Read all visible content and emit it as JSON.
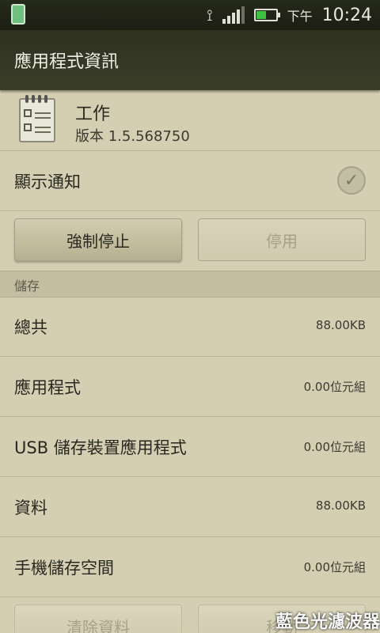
{
  "status_bar": {
    "ampm": "下午",
    "time": "10:24",
    "icons": [
      "phone-icon",
      "vibrate-icon",
      "signal-icon",
      "battery-icon"
    ],
    "battery_color": "#3fc23f"
  },
  "title_bar": {
    "title": "應用程式資訊"
  },
  "app": {
    "name": "工作",
    "version": "版本 1.5.568750",
    "icon": "notepad-checklist-icon"
  },
  "notification": {
    "label": "顯示通知",
    "checked": true
  },
  "buttons": {
    "force_stop": "強制停止",
    "disable": "停用"
  },
  "storage": {
    "header": "儲存",
    "rows": [
      {
        "label": "總共",
        "value": "88.00KB"
      },
      {
        "label": "應用程式",
        "value": "0.00位元組"
      },
      {
        "label": "USB 儲存裝置應用程式",
        "value": "0.00位元組"
      },
      {
        "label": "資料",
        "value": "88.00KB"
      },
      {
        "label": "手機儲存空間",
        "value": "0.00位元組"
      }
    ],
    "clear_data": "清除資料",
    "move": "移動"
  },
  "watermark": "藍色光濾波器"
}
